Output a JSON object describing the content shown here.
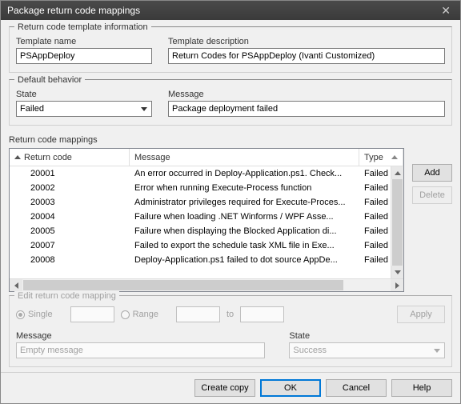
{
  "titlebar": {
    "title": "Package return code mappings"
  },
  "template_info": {
    "legend": "Return code template information",
    "name_label": "Template name",
    "name_value": "PSAppDeploy",
    "desc_label": "Template description",
    "desc_value": "Return Codes for PSAppDeploy (Ivanti Customized)"
  },
  "default_behavior": {
    "legend": "Default behavior",
    "state_label": "State",
    "state_value": "Failed",
    "message_label": "Message",
    "message_value": "Package deployment failed"
  },
  "mappings": {
    "legend": "Return code mappings",
    "columns": {
      "code": "Return code",
      "message": "Message",
      "type": "Type"
    },
    "rows": [
      {
        "code": "20001",
        "message": "An error occurred in Deploy-Application.ps1. Check...",
        "type": "Failed"
      },
      {
        "code": "20002",
        "message": "Error when running Execute-Process function",
        "type": "Failed"
      },
      {
        "code": "20003",
        "message": "Administrator privileges required for Execute-Proces...",
        "type": "Failed"
      },
      {
        "code": "20004",
        "message": "Failure when loading .NET Winforms /   WPF Asse...",
        "type": "Failed"
      },
      {
        "code": "20005",
        "message": "Failure when displaying the Blocked   Application di...",
        "type": "Failed"
      },
      {
        "code": "20007",
        "message": "Failed to export the schedule task XML  file in Exe...",
        "type": "Failed"
      },
      {
        "code": "20008",
        "message": "Deploy-Application.ps1 failed to dot source AppDe...",
        "type": "Failed"
      }
    ],
    "buttons": {
      "add": "Add",
      "delete": "Delete"
    }
  },
  "edit": {
    "legend": "Edit return code mapping",
    "single": "Single",
    "range": "Range",
    "to": "to",
    "apply": "Apply",
    "message_label": "Message",
    "message_placeholder": "Empty message",
    "state_label": "State",
    "state_value": "Success"
  },
  "footer": {
    "create_copy": "Create copy",
    "ok": "OK",
    "cancel": "Cancel",
    "help": "Help"
  }
}
